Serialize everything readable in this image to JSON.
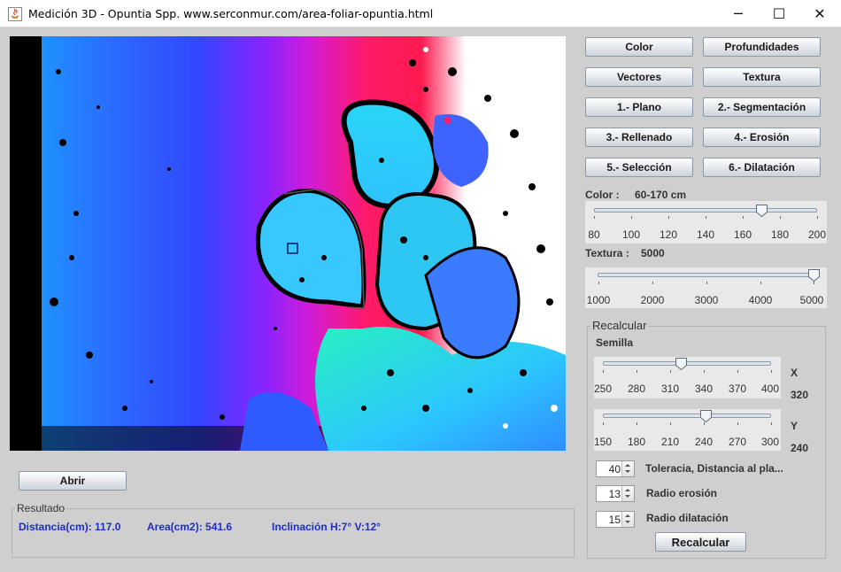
{
  "window": {
    "title": "Medición 3D - Opuntia Spp. www.serconmur.com/area-foliar-opuntia.html",
    "minimize_glyph": "─",
    "maximize_glyph": "☐",
    "close_glyph": "✕"
  },
  "buttons": {
    "color": "Color",
    "profundidades": "Profundidades",
    "vectores": "Vectores",
    "textura": "Textura",
    "plano": "1.- Plano",
    "segmentacion": "2.- Segmentación",
    "rellenado": "3.- Rellenado",
    "erosion": "4.- Erosión",
    "seleccion": "5.- Selección",
    "dilatacion": "6.- Dilatación",
    "abrir": "Abrir",
    "recalcular": "Recalcular"
  },
  "color_filter": {
    "label": "Color :",
    "range": "60-170 cm",
    "slider": {
      "min": 80,
      "max": 200,
      "value": 170,
      "ticks": [
        "80",
        "100",
        "120",
        "140",
        "160",
        "180",
        "200"
      ]
    }
  },
  "texture_filter": {
    "label": "Textura :",
    "value_text": "5000",
    "slider": {
      "min": 1000,
      "max": 5000,
      "value": 5000,
      "ticks": [
        "1000",
        "2000",
        "3000",
        "4000",
        "5000"
      ]
    }
  },
  "recalcular_group": {
    "title": "Recalcular",
    "semilla_label": "Semilla",
    "x": {
      "axis": "X",
      "value": "320",
      "min": 250,
      "max": 400,
      "current": 320,
      "ticks": [
        "250",
        "280",
        "310",
        "340",
        "370",
        "400"
      ]
    },
    "y": {
      "axis": "Y",
      "value": "240",
      "min": 150,
      "max": 300,
      "current": 240,
      "ticks": [
        "150",
        "180",
        "210",
        "240",
        "270",
        "300"
      ]
    },
    "tolerancia": {
      "value": "40",
      "label": "Toleracia, Distancia al pla..."
    },
    "erosion": {
      "value": "13",
      "label": "Radio erosión"
    },
    "dilatacion": {
      "value": "15",
      "label": "Radio dilatación"
    }
  },
  "resultado": {
    "title": "Resultado",
    "distancia": "Distancia(cm): 117.0",
    "area": "Area(cm2): 541.6",
    "inclinacion": "Inclinación H:7° V:12°"
  },
  "colors": {
    "result_text": "#1f2ec4",
    "background": "#cfcfcf",
    "depth_map": [
      "#1aa2ff",
      "#3347ff",
      "#8a23ff",
      "#d01cd8",
      "#ff1a6a",
      "#32e8e8",
      "#27f0b0"
    ]
  }
}
